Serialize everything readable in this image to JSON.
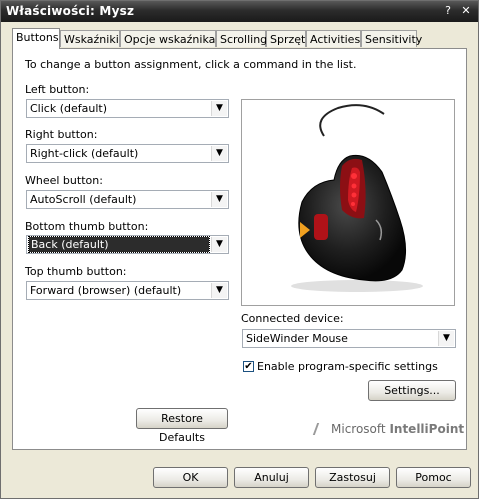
{
  "window": {
    "title": "Właściwości: Mysz",
    "help_glyph": "?",
    "close_glyph": "✕"
  },
  "tabs": [
    {
      "label": "Buttons"
    },
    {
      "label": "Wskaźniki"
    },
    {
      "label": "Opcje wskaźnika"
    },
    {
      "label": "Scrolling"
    },
    {
      "label": "Sprzęt"
    },
    {
      "label": "Activities"
    },
    {
      "label": "Sensitivity"
    }
  ],
  "buttons_tab": {
    "instruction": "To change a button assignment, click a command in the list.",
    "left": {
      "label": "Left button:",
      "value": "Click (default)"
    },
    "right": {
      "label": "Right button:",
      "value": "Right-click (default)"
    },
    "wheel": {
      "label": "Wheel button:",
      "value": "AutoScroll (default)"
    },
    "bottom_thumb": {
      "label": "Bottom thumb button:",
      "value": "Back (default)"
    },
    "top_thumb": {
      "label": "Top thumb button:",
      "value": "Forward (browser) (default)"
    },
    "connected_device": {
      "label": "Connected device:",
      "value": "SideWinder Mouse"
    },
    "enable_program_specific": {
      "label": "Enable program-specific settings",
      "checked": true
    },
    "settings_button": "Settings...",
    "restore_defaults": "Restore Defaults",
    "brand": {
      "prefix": "Microsoft",
      "product": "IntelliPoint"
    }
  },
  "dialog_buttons": {
    "ok": "OK",
    "cancel": "Anuluj",
    "apply": "Zastosuj",
    "help": "Pomoc"
  },
  "colors": {
    "title_bar": "#2c2c2c",
    "mouse_accent": "#c0141c",
    "pointer_arrow": "#f0a020",
    "selection": "#2c2c2c"
  },
  "icons": {
    "dropdown": "chevron-down-icon",
    "check": "check-icon"
  }
}
